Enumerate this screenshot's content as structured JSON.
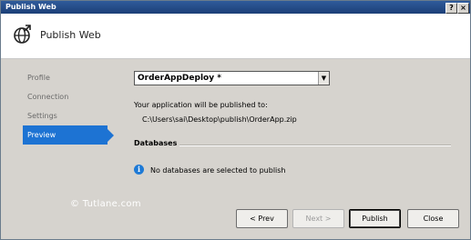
{
  "window": {
    "title": "Publish Web",
    "help_label": "?",
    "close_label": "×"
  },
  "header": {
    "title": "Publish Web",
    "icon": "globe-upload-icon"
  },
  "nav": {
    "items": [
      {
        "label": "Profile",
        "active": false
      },
      {
        "label": "Connection",
        "active": false
      },
      {
        "label": "Settings",
        "active": false
      },
      {
        "label": "Preview",
        "active": true
      }
    ]
  },
  "profile_select": {
    "value": "OrderAppDeploy *"
  },
  "publish": {
    "message": "Your application will be published to:",
    "path": "C:\\Users\\sai\\Desktop\\publish\\OrderApp.zip"
  },
  "databases": {
    "heading": "Databases",
    "info_glyph": "i",
    "message": "No databases are selected to publish"
  },
  "watermark": "© Tutlane.com",
  "buttons": {
    "prev": "< Prev",
    "next": "Next >",
    "publish": "Publish",
    "close": "Close"
  }
}
